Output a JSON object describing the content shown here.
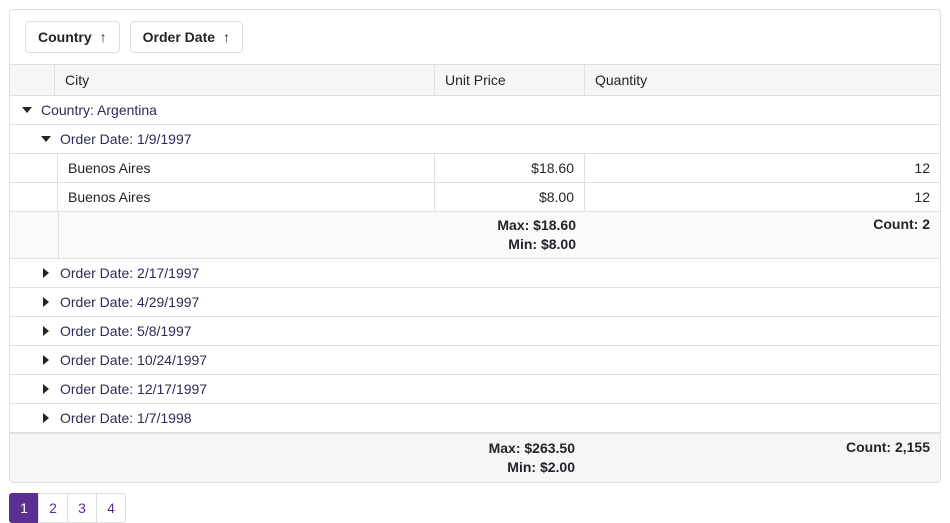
{
  "chips": [
    {
      "label": "Country"
    },
    {
      "label": "Order Date"
    }
  ],
  "columns": {
    "city": "City",
    "price": "Unit Price",
    "qty": "Quantity"
  },
  "country_group": {
    "label": "Country: Argentina"
  },
  "date_groups": [
    {
      "label": "Order Date: 1/9/1997",
      "expanded": true,
      "rows": [
        {
          "city": "Buenos Aires",
          "price": "$18.60",
          "qty": "12"
        },
        {
          "city": "Buenos Aires",
          "price": "$8.00",
          "qty": "12"
        }
      ],
      "summary": {
        "max": "Max: $18.60",
        "min": "Min: $8.00",
        "count": "Count: 2"
      }
    },
    {
      "label": "Order Date: 2/17/1997",
      "expanded": false
    },
    {
      "label": "Order Date: 4/29/1997",
      "expanded": false
    },
    {
      "label": "Order Date: 5/8/1997",
      "expanded": false
    },
    {
      "label": "Order Date: 10/24/1997",
      "expanded": false
    },
    {
      "label": "Order Date: 12/17/1997",
      "expanded": false
    },
    {
      "label": "Order Date: 1/7/1998",
      "expanded": false
    }
  ],
  "footer": {
    "max": "Max: $263.50",
    "min": "Min: $2.00",
    "count": "Count: 2,155"
  },
  "pages": [
    "1",
    "2",
    "3",
    "4"
  ]
}
